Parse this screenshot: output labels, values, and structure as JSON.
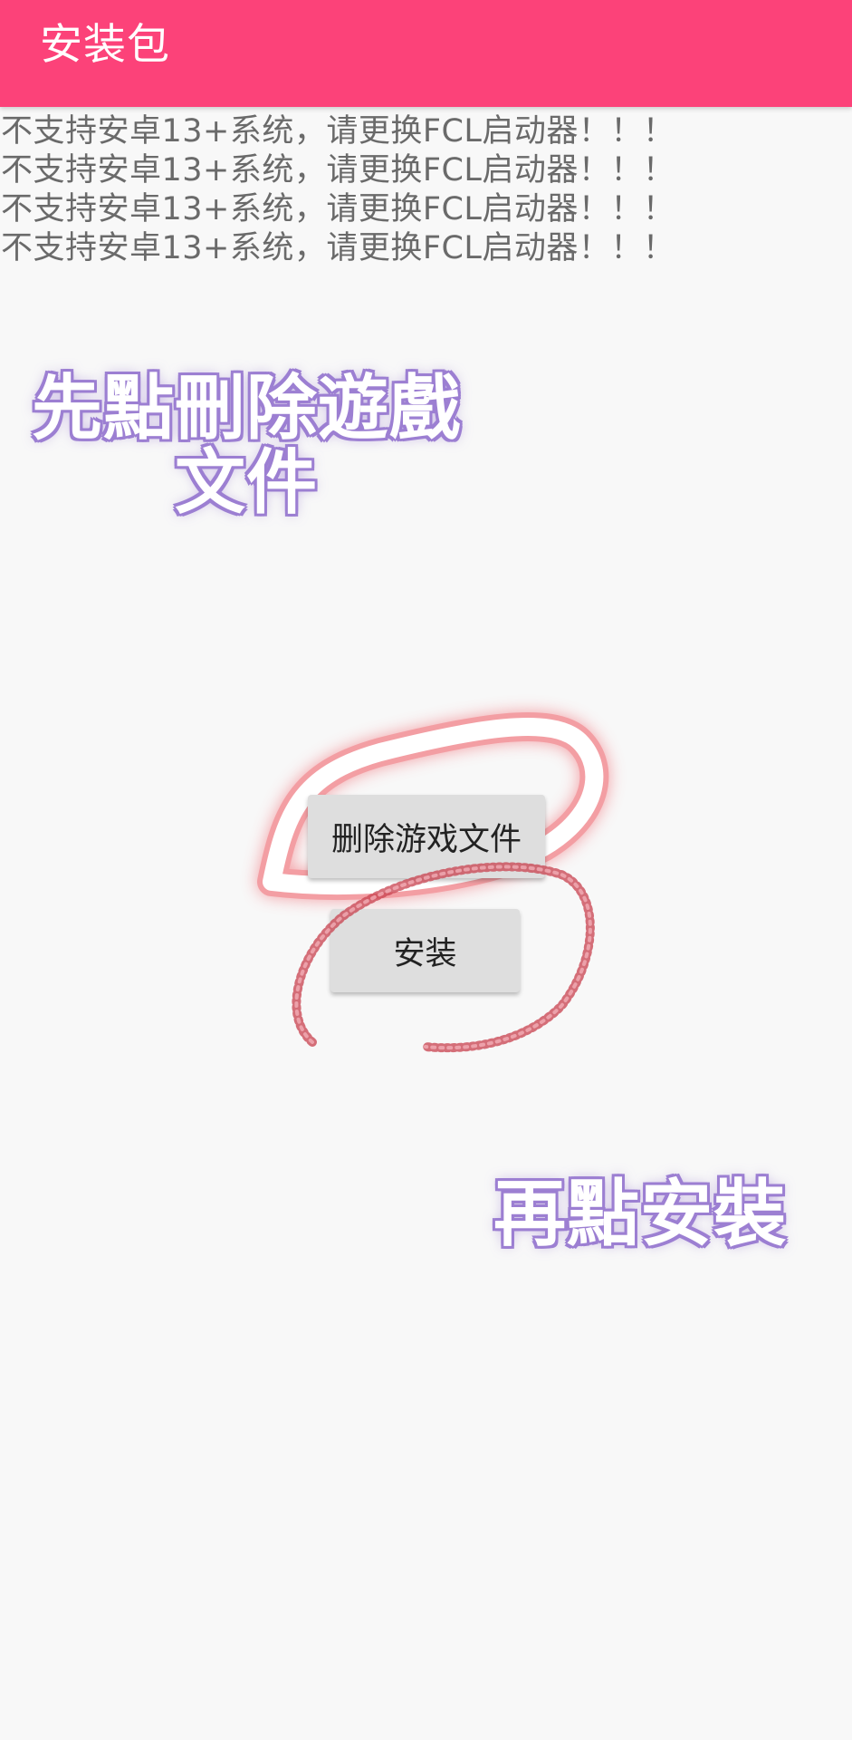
{
  "app_bar": {
    "title": "安装包"
  },
  "warnings": [
    "不支持安卓13+系统，请更换FCL启动器！！！",
    "不支持安卓13+系统，请更换FCL启动器！！！",
    "不支持安卓13+系统，请更换FCL启动器！！！",
    "不支持安卓13+系统，请更换FCL启动器！！！"
  ],
  "instructions": {
    "first": "先點刪除遊戲文件",
    "second": "再點安裝"
  },
  "buttons": {
    "delete_game_files": "删除游戏文件",
    "install": "安装"
  },
  "colors": {
    "app_bar": "#fc4279",
    "instruction_outline": "#9c7fd2",
    "circle_glow": "#f0545f",
    "loop_stroke": "#c8404e"
  }
}
